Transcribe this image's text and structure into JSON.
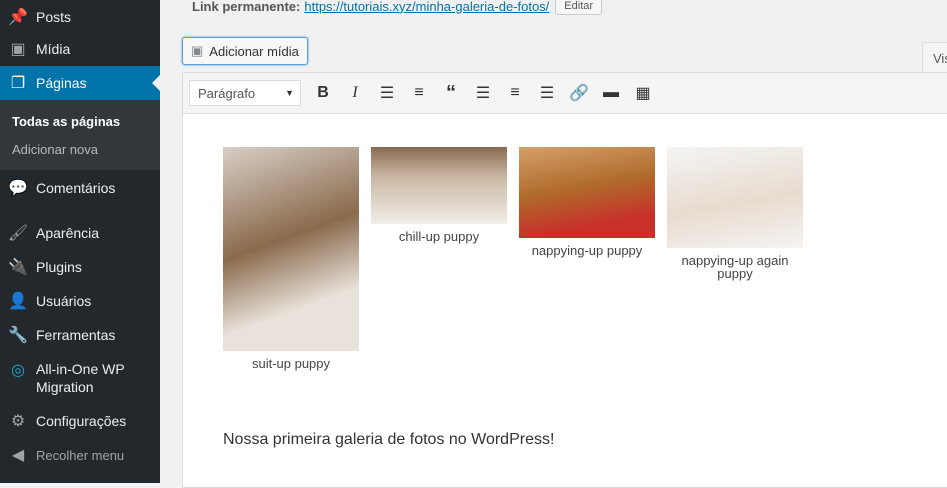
{
  "sidebar": {
    "items": [
      {
        "label": "Posts",
        "icon": "pin-icon"
      },
      {
        "label": "Mídia",
        "icon": "media-icon"
      },
      {
        "label": "Páginas",
        "icon": "pages-icon"
      },
      {
        "label": "Comentários",
        "icon": "comment-icon"
      },
      {
        "label": "Aparência",
        "icon": "brush-icon"
      },
      {
        "label": "Plugins",
        "icon": "plug-icon"
      },
      {
        "label": "Usuários",
        "icon": "user-icon"
      },
      {
        "label": "Ferramentas",
        "icon": "wrench-icon"
      },
      {
        "label": "All-in-One WP Migration",
        "icon": "migration-icon"
      },
      {
        "label": "Configurações",
        "icon": "settings-icon"
      },
      {
        "label": "Recolher menu",
        "icon": "collapse-icon"
      }
    ],
    "submenu": [
      "Todas as páginas",
      "Adicionar nova"
    ]
  },
  "permalink": {
    "label": "Link permanente:",
    "url": "https://tutoriais.xyz/minha-galeria-de-fotos/",
    "edit": "Editar"
  },
  "add_media": "Adicionar mídia",
  "tab_visual": "Vis",
  "toolbar": {
    "format": "Parágrafo"
  },
  "gallery": [
    {
      "caption": "suit-up puppy"
    },
    {
      "caption": "chill-up puppy"
    },
    {
      "caption": "nappying-up puppy"
    },
    {
      "caption": "nappying-up again puppy"
    }
  ],
  "paragraph": "Nossa primeira galeria de fotos no WordPress!"
}
